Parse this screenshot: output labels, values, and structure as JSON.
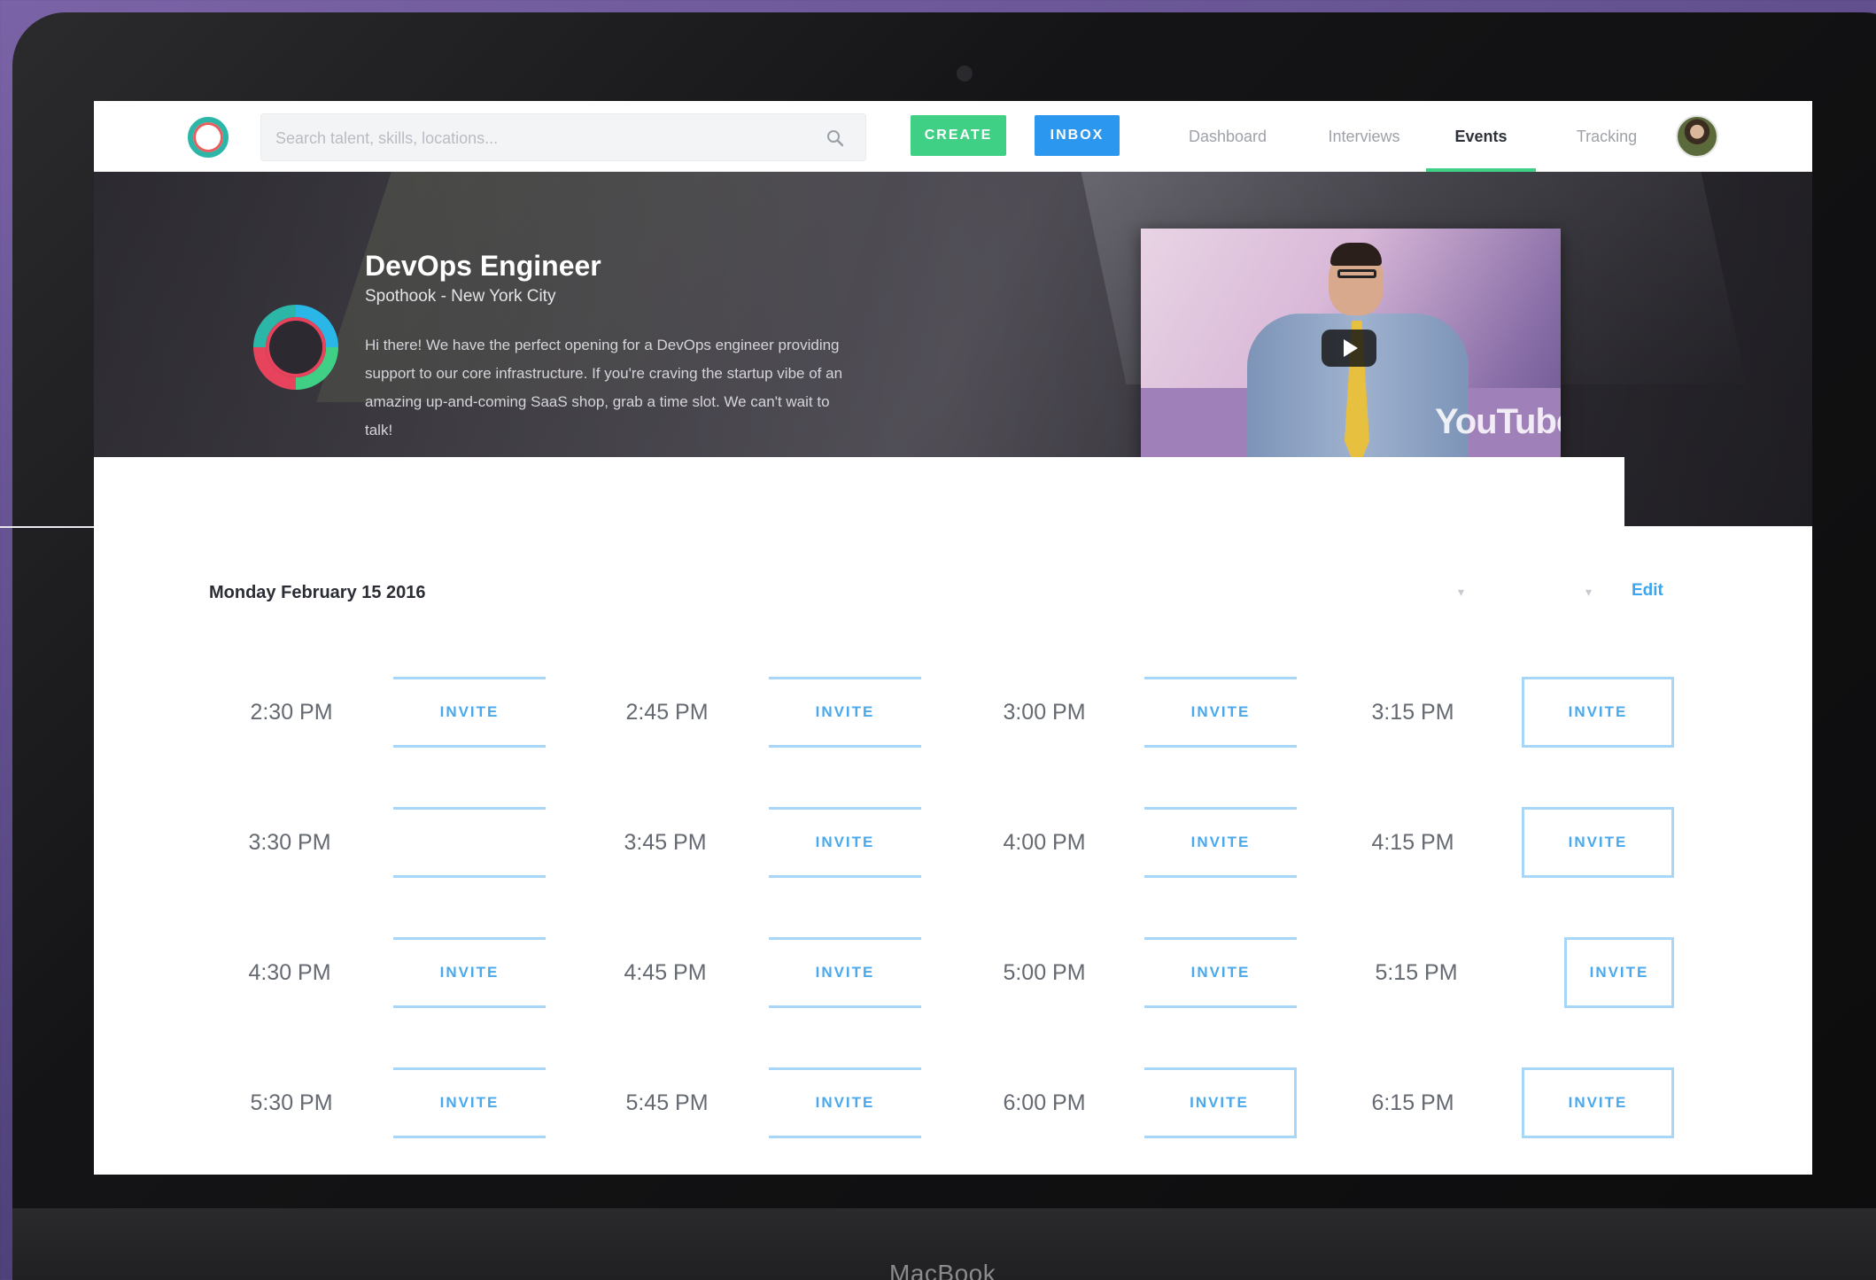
{
  "navbar": {
    "search_placeholder": "Search talent, skills, locations...",
    "create_label": "CREATE",
    "inbox_label": "INBOX",
    "tabs": [
      {
        "label": "Dashboard",
        "active": false
      },
      {
        "label": "Interviews",
        "active": false
      },
      {
        "label": "Events",
        "active": true
      },
      {
        "label": "Tracking",
        "active": false
      }
    ]
  },
  "job": {
    "title": "DevOps Engineer",
    "subtitle": "Spothook - New York City",
    "description": "Hi there! We have the perfect opening for a DevOps engineer providing support to our core infrastructure. If you're craving the startup vibe of an amazing up-and-coming SaaS shop, grab a time slot. We can't wait to talk!",
    "video_brand": "YouTube"
  },
  "schedule": {
    "date": "Monday February 15 2016",
    "edit_label": "Edit",
    "invite_label": "INVITE",
    "slots": [
      [
        "2:30 PM",
        "2:45 PM",
        "3:00 PM",
        "3:15 PM"
      ],
      [
        "3:30 PM",
        "3:45 PM",
        "4:00 PM",
        "4:15 PM"
      ],
      [
        "4:30 PM",
        "4:45 PM",
        "5:00 PM",
        "5:15 PM"
      ],
      [
        "5:30 PM",
        "5:45 PM",
        "6:00 PM",
        "6:15 PM"
      ]
    ]
  },
  "device": {
    "label": "MacBook"
  },
  "colors": {
    "create": "#3fcf85",
    "inbox": "#2c97ee",
    "invite": "#4aa8ec",
    "active_tab": "#3fcf85"
  }
}
